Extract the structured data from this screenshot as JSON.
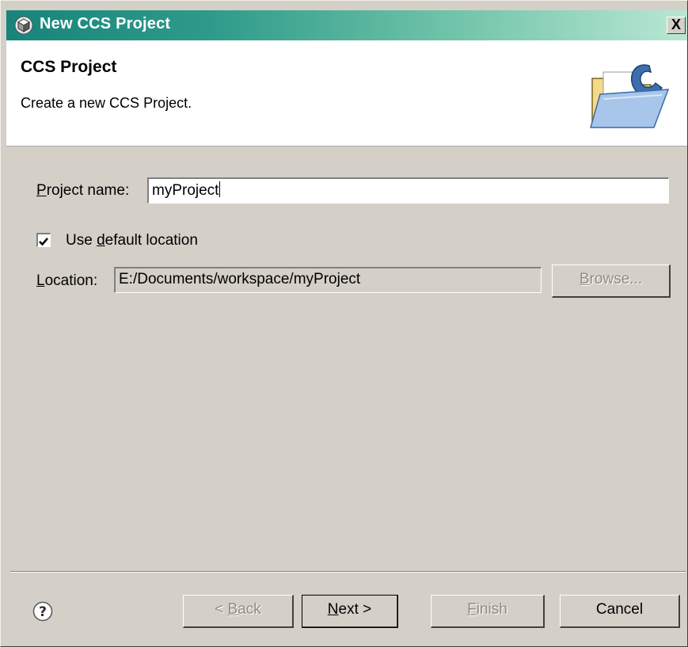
{
  "window": {
    "title": "New CCS Project",
    "close_label": "X"
  },
  "banner": {
    "title": "CCS Project",
    "description": "Create a new CCS Project.",
    "icon": "folder-c-icon"
  },
  "form": {
    "project_name_label_u": "P",
    "project_name_label_rest": "roject name:",
    "project_name_value": "myProject",
    "use_default_location_checked": true,
    "use_default_label_pre": "Use ",
    "use_default_label_u": "d",
    "use_default_label_rest": "efault location",
    "location_label_u": "L",
    "location_label_rest": "ocation:",
    "location_value": "E:/Documents/workspace/myProject",
    "browse_u": "B",
    "browse_rest": "rowse..."
  },
  "footer": {
    "back_pre": "< ",
    "back_u": "B",
    "back_rest": "ack",
    "next_u": "N",
    "next_rest": "ext >",
    "finish_u": "F",
    "finish_rest": "inish",
    "cancel_label": "Cancel"
  },
  "colors": {
    "title_bar_start": "#18847a",
    "title_bar_end": "#b9e7d4",
    "dialog_bg": "#d4d0c8"
  }
}
